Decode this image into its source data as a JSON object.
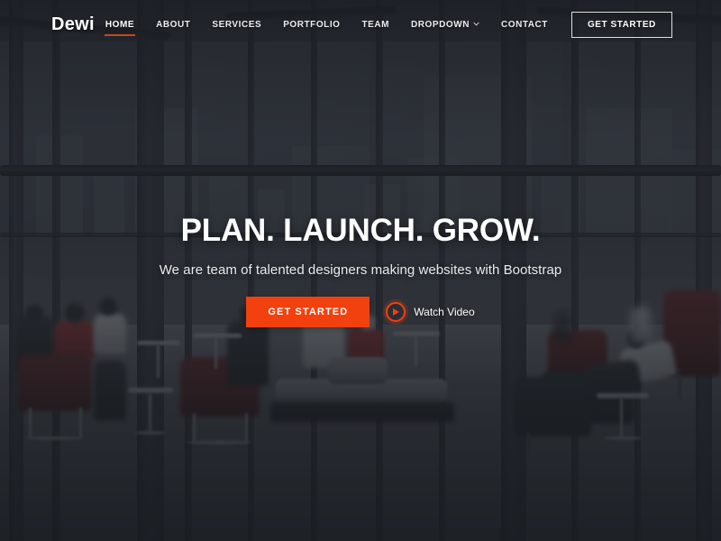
{
  "site": {
    "brand": "Dewi",
    "accent_color": "#f2400f",
    "nav_underline_color": "#c2491c",
    "overlay_color": "#1a1d22"
  },
  "navbar": {
    "brand_label": "Dewi",
    "items": [
      {
        "label": "HOME",
        "active": true,
        "icon": null
      },
      {
        "label": "ABOUT",
        "active": false,
        "icon": null
      },
      {
        "label": "SERVICES",
        "active": false,
        "icon": null
      },
      {
        "label": "PORTFOLIO",
        "active": false,
        "icon": null
      },
      {
        "label": "TEAM",
        "active": false,
        "icon": null
      },
      {
        "label": "DROPDOWN",
        "active": false,
        "icon": "chevron-down-icon"
      },
      {
        "label": "CONTACT",
        "active": false,
        "icon": null
      }
    ],
    "cta_label": "GET STARTED"
  },
  "hero": {
    "title": "PLAN. LAUNCH. GROW.",
    "subtitle": "We are team of talented designers making websites with Bootstrap",
    "primary_button_label": "GET STARTED",
    "video_link_label": "Watch Video",
    "video_icon": "play-icon",
    "background": {
      "description": "Dark-overlaid photo of a modern glass-walled atrium lounge with city skyline beyond, people seated in red and dark armchairs",
      "tint": "dark"
    }
  }
}
